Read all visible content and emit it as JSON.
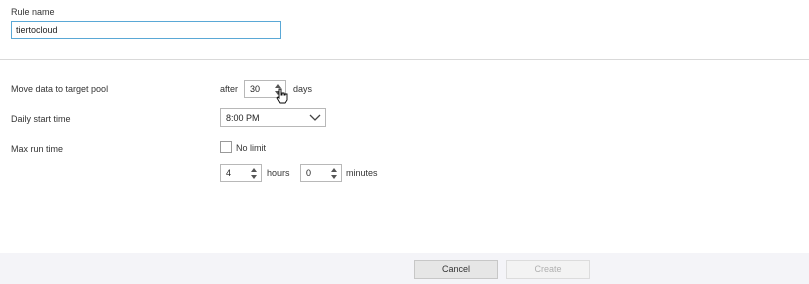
{
  "rule_name": {
    "label": "Rule name",
    "value": "tiertocloud"
  },
  "move_data": {
    "label": "Move data to target pool",
    "prefix": "after",
    "value": "30",
    "suffix": "days"
  },
  "daily_start": {
    "label": "Daily start time",
    "selected": "8:00 PM"
  },
  "max_run": {
    "label": "Max run time",
    "no_limit_label": "No limit",
    "no_limit_checked": false,
    "hours_value": "4",
    "hours_label": "hours",
    "minutes_value": "0",
    "minutes_label": "minutes"
  },
  "footer": {
    "cancel_label": "Cancel",
    "create_label": "Create"
  }
}
